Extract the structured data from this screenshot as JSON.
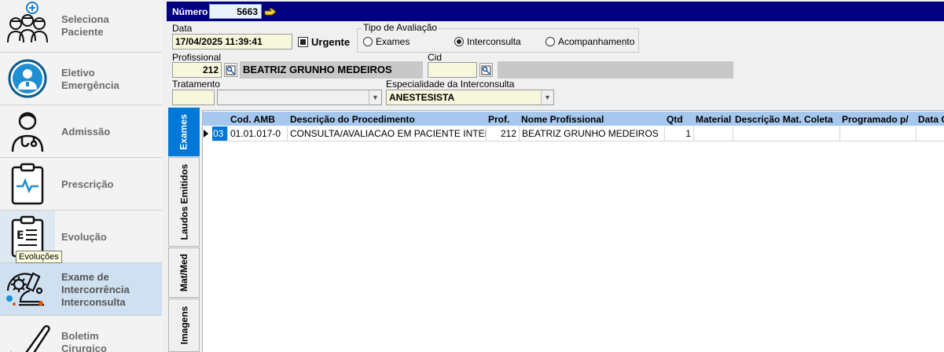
{
  "sidebar": {
    "items": [
      {
        "line1": "Seleciona",
        "line2": "Paciente",
        "line3": "",
        "icon": "team-doctors-icon"
      },
      {
        "line1": "Eletivo",
        "line2": "Emergência",
        "line3": "",
        "icon": "doctor-badge-icon"
      },
      {
        "line1": "Admissão",
        "line2": "",
        "line3": "",
        "icon": "doctor-stethoscope-icon"
      },
      {
        "line1": "Prescrição",
        "line2": "",
        "line3": "",
        "icon": "clipboard-pulse-icon"
      },
      {
        "line1": "Evolução",
        "line2": "",
        "line3": "",
        "icon": "clipboard-evolution-icon"
      },
      {
        "line1": "Exame de",
        "line2": "Intercorrência",
        "line3": "Interconsulta",
        "icon": "microscope-virus-icon"
      },
      {
        "line1": "Boletim",
        "line2": "Cirurgico",
        "line3": "",
        "icon": "scalpel-blood-icon"
      }
    ],
    "tooltip": "Evoluções"
  },
  "header": {
    "numero_label": "Número",
    "numero_value": "5663"
  },
  "form": {
    "data_label": "Data",
    "data_value": "17/04/2025 11:39:41",
    "urgente_label": "Urgente",
    "urgente_checked": true,
    "tipo_legend": "Tipo de Avaliação",
    "tipo_options": [
      "Exames",
      "Interconsulta",
      "Acompanhamento"
    ],
    "tipo_selected": "Interconsulta",
    "profissional_label": "Profissional",
    "profissional_code": "212",
    "profissional_name": "BEATRIZ GRUNHO MEDEIROS",
    "cid_label": "Cid",
    "cid_code": "",
    "cid_desc": "",
    "tratamento_label": "Tratamento",
    "tratamento_code": "",
    "tratamento_value": "",
    "especialidade_label": "Especialidade da Interconsulta",
    "especialidade_value": "ANESTESISTA"
  },
  "tabs": [
    "Exames",
    "Laudos Emitidos",
    "Mat/Med",
    "Imagens"
  ],
  "active_tab": "Exames",
  "grid": {
    "columns": [
      "Cod. AMB",
      "Descrição do Procedimento",
      "Prof.",
      "Nome Profissional",
      "Qtd",
      "Material",
      "Descrição Mat. Coleta",
      "Programado p/",
      "Data C"
    ],
    "rows": [
      {
        "seq": "03",
        "cod_amb": "01.01.017-0",
        "descricao": "CONSULTA/AVALIACAO EM PACIENTE INTER",
        "prof": "212",
        "nome": "BEATRIZ GRUNHO MEDEIROS",
        "qtd": "1",
        "material": "",
        "desc_mat": "",
        "programado": "",
        "data_c": ""
      }
    ]
  },
  "colors": {
    "header_bar": "#000080",
    "active_tab": "#0078d7",
    "grid_header": "#a6c8ee",
    "field_bg": "#f7f7dc"
  }
}
